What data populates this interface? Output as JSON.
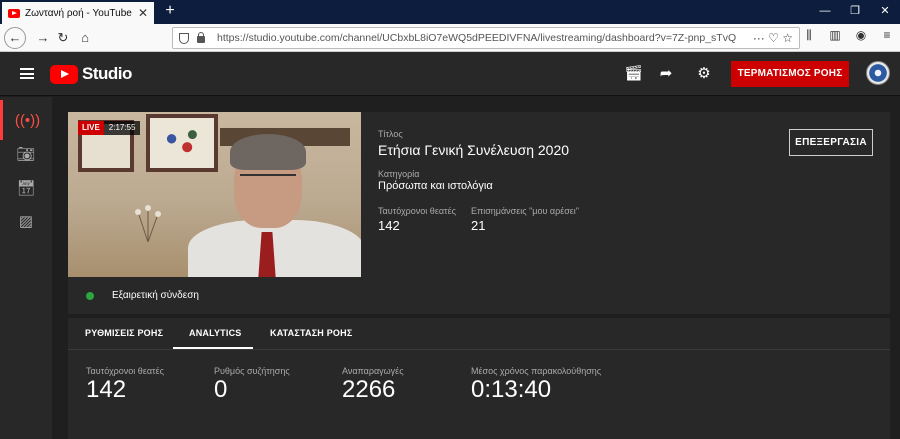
{
  "browser": {
    "tab_title": "Ζωντανή ροή - YouTube Studio",
    "url": "https://studio.youtube.com/channel/UCbxbL8iO7eWQ5dPEEDIVFNA/livestreaming/dashboard?v=7Z-pnp_sTvQ",
    "url_actions": "···"
  },
  "header": {
    "logo_text": "Studio",
    "end_stream_label": "ΤΕΡΜΑΤΙΣΜΟΣ ΡΟΗΣ"
  },
  "stream": {
    "live_label": "LIVE",
    "elapsed": "2:17:55",
    "connection_status": "Εξαιρετική σύνδεση",
    "title_label": "Τίτλος",
    "title": "Ετήσια Γενική Συνέλευση 2020",
    "category_label": "Κατηγορία",
    "category": "Πρόσωπα και ιστολόγια",
    "concurrent_label": "Ταυτόχρονοι θεατές",
    "concurrent_value": "142",
    "likes_label": "Επισημάνσεις \"μου αρέσει\"",
    "likes_value": "21",
    "edit_label": "ΕΠΕΞΕΡΓΑΣΙΑ",
    "status_color": "#2ba640",
    "accent_color": "#cc0000"
  },
  "tabs": [
    {
      "label": "ΡΥΘΜΙΣΕΙΣ ΡΟΗΣ"
    },
    {
      "label": "ANALYTICS"
    },
    {
      "label": "ΚΑΤΑΣΤΑΣΗ ΡΟΗΣ"
    }
  ],
  "stats": [
    {
      "label": "Ταυτόχρονοι θεατές",
      "value": "142"
    },
    {
      "label": "Ρυθμός συζήτησης",
      "value": "0"
    },
    {
      "label": "Αναπαραγωγές",
      "value": "2266"
    },
    {
      "label": "Μέσος χρόνος παρακολούθησης",
      "value": "0:13:40"
    }
  ]
}
